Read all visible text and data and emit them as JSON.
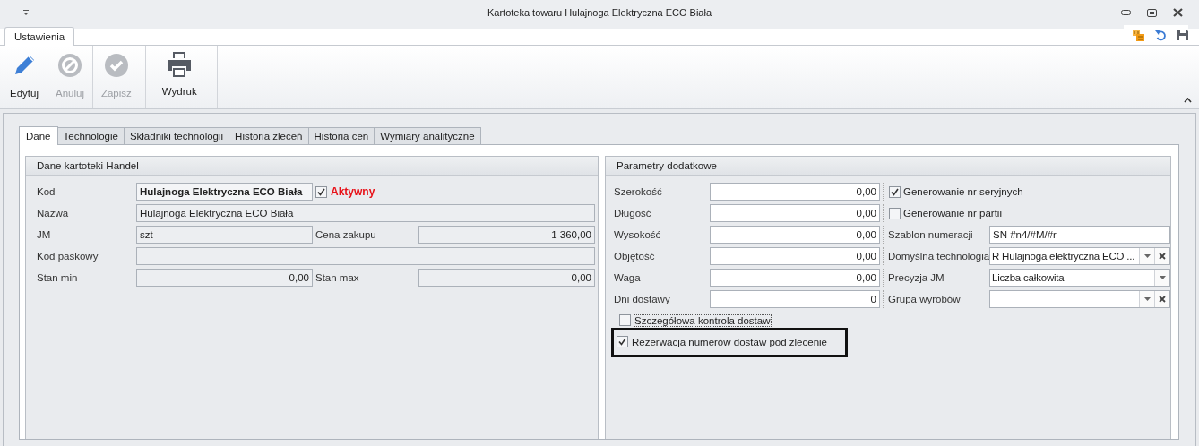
{
  "window": {
    "title": "Kartoteka towaru Hulajnoga Elektryczna ECO Biała"
  },
  "ribbon": {
    "tabs": [
      {
        "label": "Ustawienia",
        "selected": true
      }
    ],
    "groups": [
      [
        {
          "label": "Edytuj",
          "disabled": false
        },
        {
          "label": "Anuluj",
          "disabled": true
        },
        {
          "label": "Zapisz",
          "disabled": true
        }
      ],
      [
        {
          "label": "Wydruk",
          "disabled": false
        }
      ]
    ]
  },
  "page_tabs": [
    {
      "label": "Dane",
      "selected": true
    },
    {
      "label": "Technologie",
      "selected": false
    },
    {
      "label": "Składniki technologii",
      "selected": false
    },
    {
      "label": "Historia zleceń",
      "selected": false
    },
    {
      "label": "Historia cen",
      "selected": false
    },
    {
      "label": "Wymiary analityczne",
      "selected": false
    }
  ],
  "left_panel": {
    "title": "Dane kartoteki Handel",
    "rows": [
      [
        {
          "kind": "text",
          "label": "Kod",
          "value": "Hulajnoga Elektryczna ECO Biała",
          "bold": true
        },
        {
          "kind": "checkbox",
          "label": "Aktywny",
          "checked": true
        }
      ],
      [
        {
          "kind": "text",
          "label": "Nazwa",
          "value": "Hulajnoga Elektryczna ECO Biała",
          "bold": false
        }
      ],
      [
        {
          "kind": "text",
          "label": "JM",
          "value": "szt",
          "bold": false
        },
        {
          "kind": "number",
          "label": "Cena zakupu",
          "value": "1 360,00"
        }
      ],
      [
        {
          "kind": "text",
          "label": "Kod paskowy"
        }
      ],
      [
        {
          "kind": "number",
          "label": "Stan min",
          "value": "0,00"
        },
        {
          "kind": "number",
          "label": "Stan max",
          "value": "0,00"
        }
      ]
    ]
  },
  "right_panel": {
    "title": "Parametry dodatkowe",
    "left_fields": [
      {
        "label": "Szerokość",
        "value": "0,00"
      },
      {
        "label": "Długość",
        "value": "0,00"
      },
      {
        "label": "Wysokość",
        "value": "0,00"
      },
      {
        "label": "Objętość",
        "value": "0,00"
      },
      {
        "label": "Waga",
        "value": "0,00"
      },
      {
        "label": "Dni dostawy",
        "value": "0"
      }
    ],
    "right_fields": [
      {
        "kind": "checkbox",
        "label": "Generowanie nr seryjnych",
        "checked": true
      },
      {
        "kind": "checkbox",
        "label": "Generowanie nr partii",
        "checked": false
      },
      {
        "kind": "text",
        "label": "Szablon numeracji",
        "value": "SN #n4/#M/#r"
      },
      {
        "kind": "combo",
        "label": "Domyślna technologia",
        "value": "R Hulajnoga elektryczna ECO ...",
        "clear_button": true
      },
      {
        "kind": "combo",
        "label": "Precyzja JM",
        "value": "Liczba całkowita",
        "clear_button": false
      },
      {
        "kind": "combo",
        "label": "Grupa wyrobów",
        "clear_button": true
      }
    ],
    "checkboxes": [
      {
        "label": "Szczegółowa kontrola dostaw",
        "checked": false,
        "focused": true,
        "highlighted": false
      },
      {
        "label": "Rezerwacja numerów dostaw pod zlecenie",
        "checked": true,
        "focused": false,
        "highlighted": true
      }
    ]
  }
}
